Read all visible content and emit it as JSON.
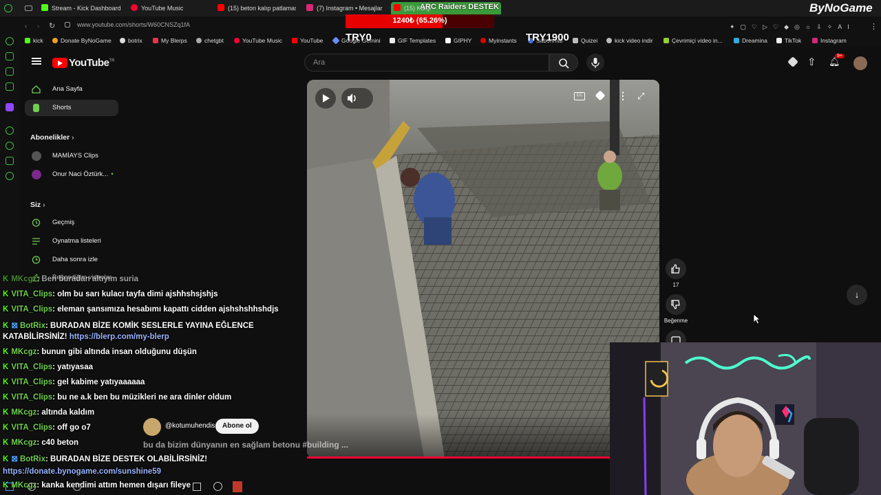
{
  "browser": {
    "tabs": [
      "Stream - Kick Dashboard",
      "YouTube Music",
      "(15) beton kalıp patlaması",
      "(7) Instagram • Mesajlar",
      "(15) Kalıp"
    ],
    "url": "www.youtube.com/shorts/W60CNSZq1fA",
    "bookmarks": [
      "kick",
      "Donate ByNoGame",
      "botrix",
      "My Blerps",
      "chetgbt",
      "YouTube Music",
      "YouTube",
      "Google Gemini",
      "GIF Templates",
      "GIPHY",
      "Myinstants",
      "Sabonmal",
      "Quizei",
      "kick video indir",
      "Çevrimiçi video in...",
      "Dreamina",
      "TikTok",
      "Instagram"
    ]
  },
  "overlay": {
    "title": "ARC Raiders DESTEK",
    "progress_text": "1240₺ (65.26%)",
    "progress_fraction": 0.6526,
    "left_label": "TRY0",
    "right_label": "TRY1900",
    "brand": "ByNoGame"
  },
  "youtube": {
    "logo_text": "YouTube",
    "logo_sup": "TR",
    "search_placeholder": "Ara",
    "notif_badge": "9+",
    "sidebar": {
      "home": "Ana Sayfa",
      "shorts": "Shorts",
      "subs_header": "Abonelikler",
      "subs": [
        "MAMİAYS Clips",
        "Onur Naci Öztürk..."
      ],
      "you_header": "Siz",
      "you_items": [
        "Geçmiş",
        "Oynatma listeleri",
        "Daha sonra izle",
        "Beğendiğim videolar"
      ]
    },
    "short": {
      "channel": "@kotumuhendis",
      "subscribe": "Abone ol",
      "title": "bu da bizim dünyanın en sağlam betonu #building ...",
      "likes": "17",
      "dislike_label": "Beğenme"
    }
  },
  "chat": [
    {
      "user": "MKcgz",
      "text": ": Ben buradan altıyım suria"
    },
    {
      "user": "VITA_Clips",
      "text": ": olm bu sarı kulacı tayfa dimi ajshhshsjshjs"
    },
    {
      "user": "VITA_Clips",
      "text": ": eleman şansımıza hesabımı kapattı cidden ajshshshhshdjs"
    },
    {
      "user": "BotRix",
      "text": ": BURADAN BİZE KOMİK SESLERLE YAYINA EĞLENCE"
    },
    {
      "user": "",
      "text": "KATABİLİRSİNİZ!",
      "link": "https://blerp.com/my-blerp"
    },
    {
      "user": "MKcgz",
      "text": ": bunun gibi altında insan olduğunu düşün"
    },
    {
      "user": "VITA_Clips",
      "text": ": yatıyasaa"
    },
    {
      "user": "VITA_Clips",
      "text": ": gel kabime yatıyaaaaaa"
    },
    {
      "user": "VITA_Clips",
      "text": ": bu ne a.k ben bu müzikleri ne ara dinler oldum"
    },
    {
      "user": "MKcgz",
      "text": ": altında kaldım"
    },
    {
      "user": "VITA_Clips",
      "text": ": off go o7"
    },
    {
      "user": "MKcgz",
      "text": ": c40 beton"
    },
    {
      "user": "BotRix",
      "text": ": BURADAN BİZE DESTEK OLABİLİRSİNİZ!"
    },
    {
      "user": "",
      "text": "",
      "link": "https://donate.bynogame.com/sunshine59"
    },
    {
      "user": "MKcgz",
      "text": ": kanka kendimi attım hemen dışarı fileye"
    }
  ],
  "colors": {
    "accent": "#ff0000",
    "kick": "#53fc18",
    "bg": "#0f0f0f"
  }
}
